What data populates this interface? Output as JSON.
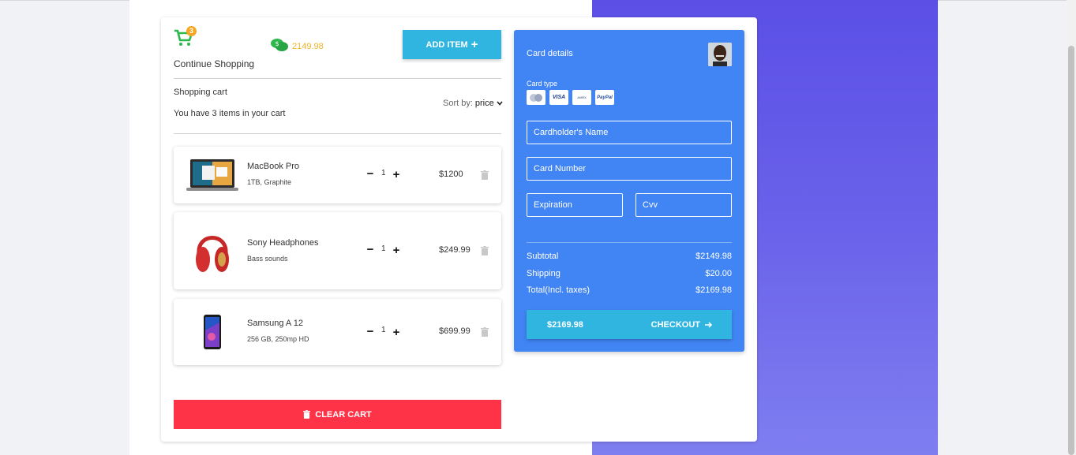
{
  "header": {
    "cart_badge_count": "3",
    "continue_label": "Continue Shopping",
    "total_amount": "2149.98",
    "add_item_label": "ADD ITEM"
  },
  "cart": {
    "title": "Shopping cart",
    "count_text": "You have 3 items in your cart",
    "sort_label": "Sort by:",
    "sort_value": "price",
    "items": [
      {
        "name": "MacBook Pro",
        "sub": "1TB, Graphite",
        "qty": "1",
        "price": "$1200"
      },
      {
        "name": "Sony Headphones",
        "sub": "Bass sounds",
        "qty": "1",
        "price": "$249.99"
      },
      {
        "name": "Samsung A 12",
        "sub": "256 GB, 250mp HD",
        "qty": "1",
        "price": "$699.99"
      }
    ],
    "clear_label": "CLEAR CART"
  },
  "card": {
    "title": "Card details",
    "type_label": "Card type",
    "logos": [
      "MC",
      "VISA",
      "AMEX",
      "PayPal"
    ],
    "name_placeholder": "Cardholder's Name",
    "number_placeholder": "Card Number",
    "expiration_placeholder": "Expiration",
    "cvv_placeholder": "Cvv",
    "subtotal_label": "Subtotal",
    "subtotal_value": "$2149.98",
    "shipping_label": "Shipping",
    "shipping_value": "$20.00",
    "total_label": "Total(Incl. taxes)",
    "total_value": "$2169.98",
    "checkout_amount": "$2169.98",
    "checkout_label": "CHECKOUT"
  },
  "colors": {
    "accent": "#2fb5e0",
    "danger": "#ff3347",
    "panel": "#4184f3",
    "cart_green": "#2db84d",
    "money_yellow": "#f0b429"
  }
}
